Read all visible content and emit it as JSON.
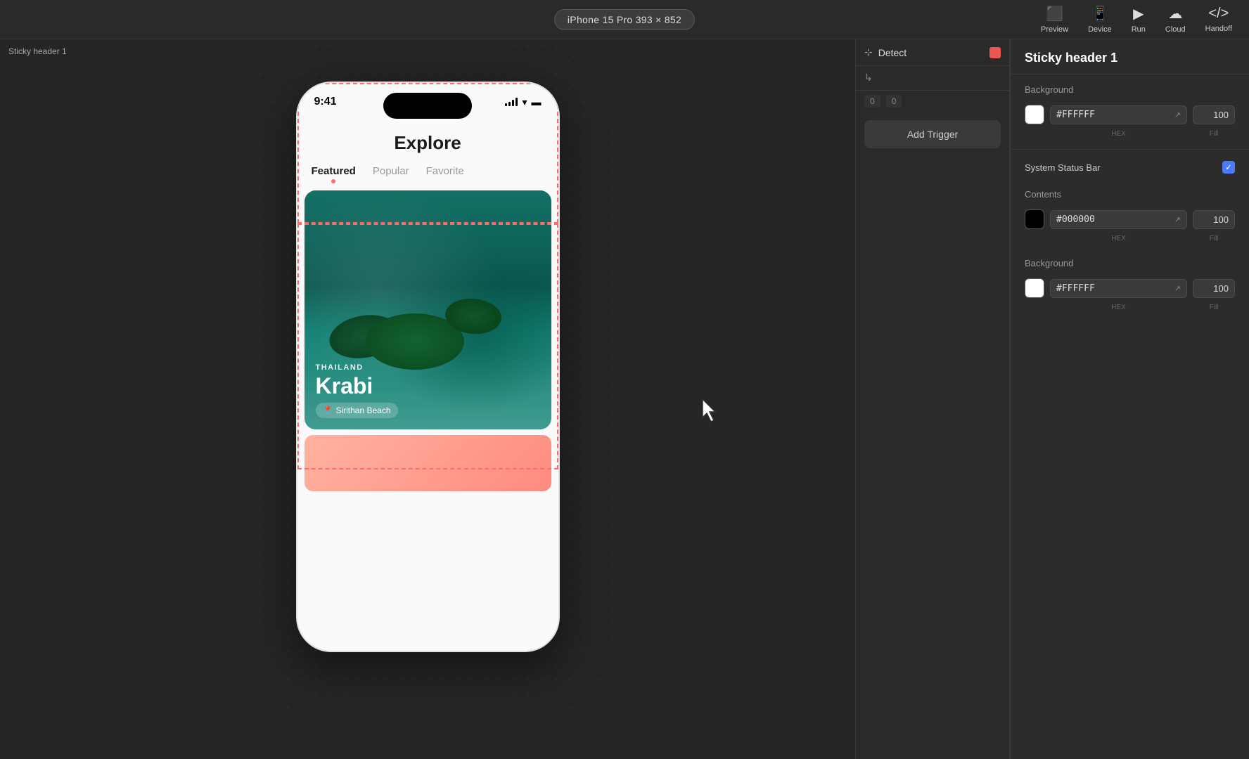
{
  "toolbar": {
    "device_label": "iPhone 15 Pro  393 × 852",
    "preview_label": "Preview",
    "device_label2": "Device",
    "run_label": "Run",
    "cloud_label": "Cloud",
    "handoff_label": "Handoff"
  },
  "canvas": {
    "canvas_label": "Sticky header 1"
  },
  "phone": {
    "status_time": "9:41",
    "explore_title": "Explore",
    "tab_featured": "Featured",
    "tab_popular": "Popular",
    "tab_favorite": "Favorite",
    "card_country": "THAILAND",
    "card_city": "Krabi",
    "card_location_pin": "📍",
    "card_location": "Sirithan Beach"
  },
  "detect_panel": {
    "title": "Detect",
    "add_trigger_label": "Add Trigger",
    "num1": "0",
    "num2": "0"
  },
  "right_panel": {
    "title": "Sticky header 1",
    "background_label": "Background",
    "background_hex": "#FFFFFF",
    "background_fill": "100",
    "background_hex_label": "HEX",
    "background_fill_label": "Fill",
    "system_status_bar_label": "System Status Bar",
    "contents_label": "Contents",
    "contents_hex": "#000000",
    "contents_fill": "100",
    "contents_hex_label": "HEX",
    "contents_fill_label": "Fill",
    "background2_label": "Background",
    "background2_hex": "#FFFFFF",
    "background2_fill": "100",
    "background2_hex_label": "HEX",
    "background2_fill_label": "Fill"
  }
}
